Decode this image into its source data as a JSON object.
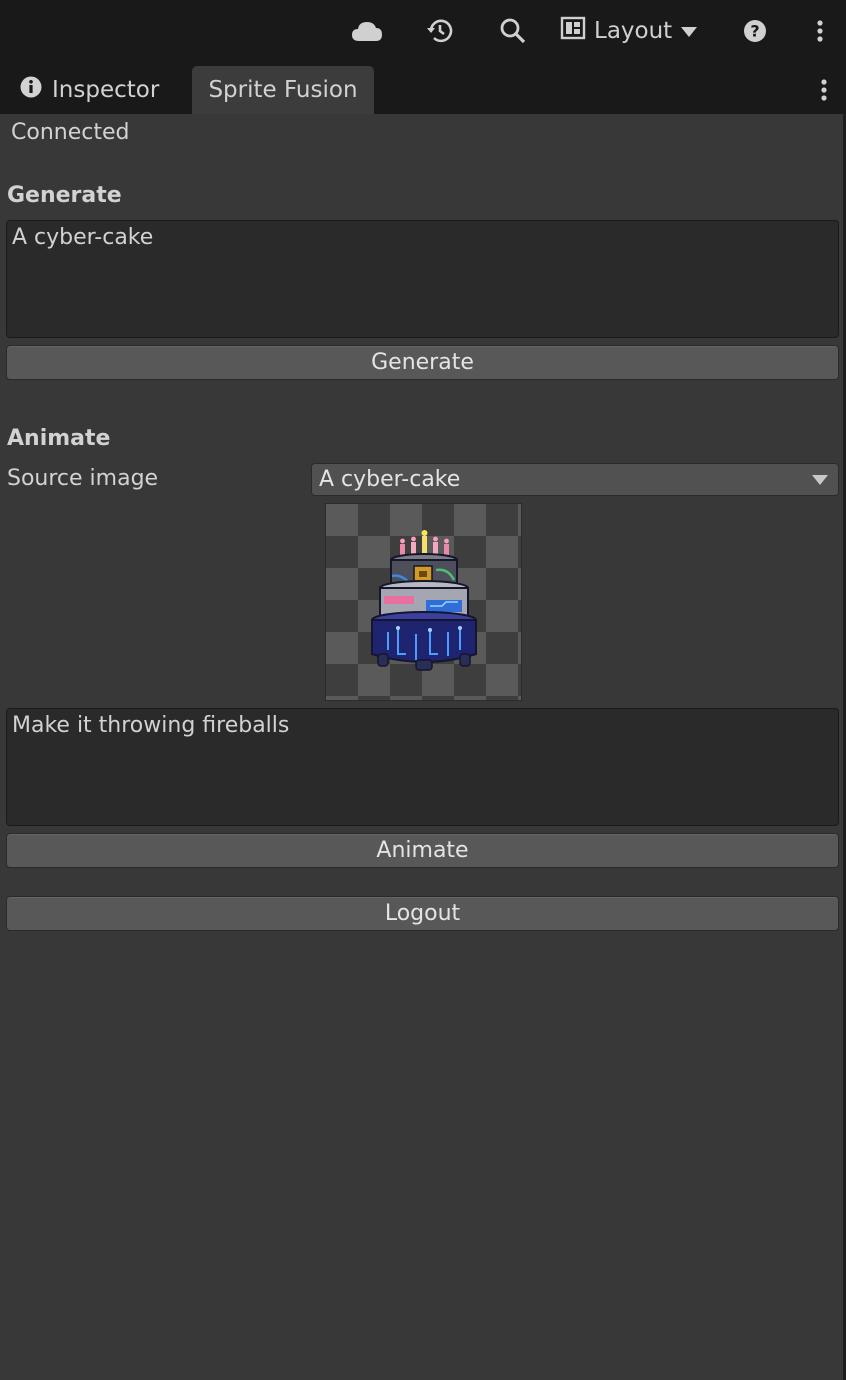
{
  "toolbar": {
    "icons": [
      "cloud-icon",
      "history-icon",
      "search-icon",
      "layout-icon",
      "help-icon",
      "more-vertical-icon"
    ],
    "layout_label": "Layout"
  },
  "tabs": [
    {
      "label": "Inspector",
      "icon": "info-icon",
      "active": false
    },
    {
      "label": "Sprite Fusion",
      "active": true
    }
  ],
  "status": "Connected",
  "generate": {
    "title": "Generate",
    "prompt_value": "A cyber-cake",
    "button_label": "Generate"
  },
  "animate": {
    "title": "Animate",
    "source_label": "Source image",
    "source_selected": "A cyber-cake",
    "prompt_value": "Make it throwing fireballs",
    "button_label": "Animate"
  },
  "logout_label": "Logout",
  "colors": {
    "background": "#383838",
    "toolbar": "#191919",
    "button": "#585858",
    "field": "#2a2a2a"
  }
}
